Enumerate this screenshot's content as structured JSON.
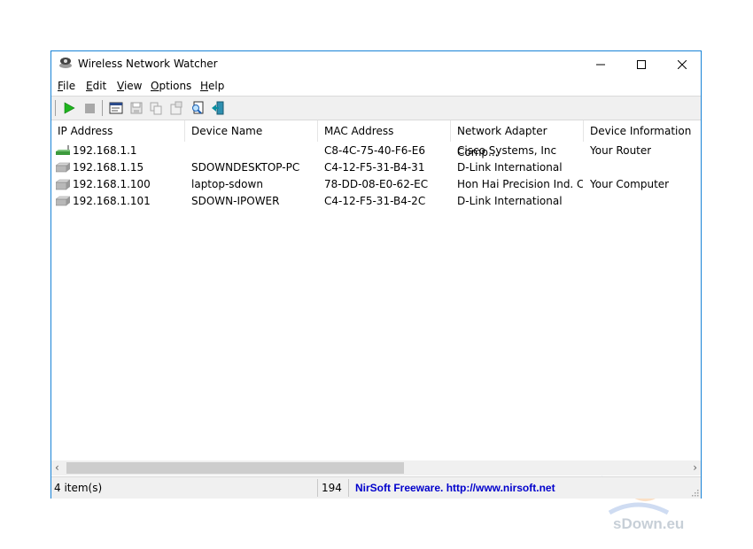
{
  "window": {
    "title": "Wireless Network Watcher",
    "controls": {
      "minimize": "minimize",
      "maximize": "maximize",
      "close": "close"
    }
  },
  "menu": {
    "items": [
      {
        "label": "File",
        "accel": "F",
        "rest": "ile"
      },
      {
        "label": "Edit",
        "accel": "E",
        "rest": "dit"
      },
      {
        "label": "View",
        "accel": "V",
        "rest": "iew"
      },
      {
        "label": "Options",
        "accel": "O",
        "rest": "ptions"
      },
      {
        "label": "Help",
        "accel": "H",
        "rest": "elp"
      }
    ]
  },
  "toolbar": {
    "buttons": [
      {
        "name": "start-scan",
        "icon": "play-icon",
        "enabled": true
      },
      {
        "name": "stop-scan",
        "icon": "stop-icon",
        "enabled": false
      },
      {
        "name": "html-report",
        "icon": "report-window-icon",
        "enabled": true
      },
      {
        "name": "save-selected",
        "icon": "floppy-disk-icon",
        "enabled": false
      },
      {
        "name": "copy-selected",
        "icon": "copy-icon",
        "enabled": false
      },
      {
        "name": "properties",
        "icon": "properties-icon",
        "enabled": false
      },
      {
        "name": "find",
        "icon": "find-icon",
        "enabled": true
      },
      {
        "name": "exit",
        "icon": "exit-door-icon",
        "enabled": true
      }
    ]
  },
  "table": {
    "columns": [
      "IP Address",
      "Device Name",
      "MAC Address",
      "Network Adapter Comp...",
      "Device Information"
    ],
    "rows": [
      {
        "icon": "router-icon",
        "ip": "192.168.1.1",
        "device_name": "",
        "mac": "C8-4C-75-40-F6-E6",
        "vendor": "Cisco Systems, Inc",
        "info": "Your Router"
      },
      {
        "icon": "computer-icon",
        "ip": "192.168.1.15",
        "device_name": "SDOWNDESKTOP-PC",
        "mac": "C4-12-F5-31-B4-31",
        "vendor": "D-Link International",
        "info": ""
      },
      {
        "icon": "computer-icon",
        "ip": "192.168.1.100",
        "device_name": "laptop-sdown",
        "mac": "78-DD-08-E0-62-EC",
        "vendor": "Hon Hai Precision Ind. C...",
        "info": "Your Computer"
      },
      {
        "icon": "computer-icon",
        "ip": "192.168.1.101",
        "device_name": "SDOWN-IPOWER",
        "mac": "C4-12-F5-31-B4-2C",
        "vendor": "D-Link International",
        "info": ""
      }
    ]
  },
  "scrollbar": {
    "left_arrow": "‹",
    "right_arrow": "›",
    "position": 0.0
  },
  "status": {
    "items_count": "4 item(s)",
    "value": "194",
    "credit": "NirSoft Freeware.  http://www.nirsoft.net"
  },
  "watermark": {
    "text": "sDown.eu"
  },
  "colors": {
    "window_border": "#1883d7",
    "credit_text": "#0000cc",
    "play_green": "#1fb51f",
    "router_green": "#3c9a3c"
  }
}
